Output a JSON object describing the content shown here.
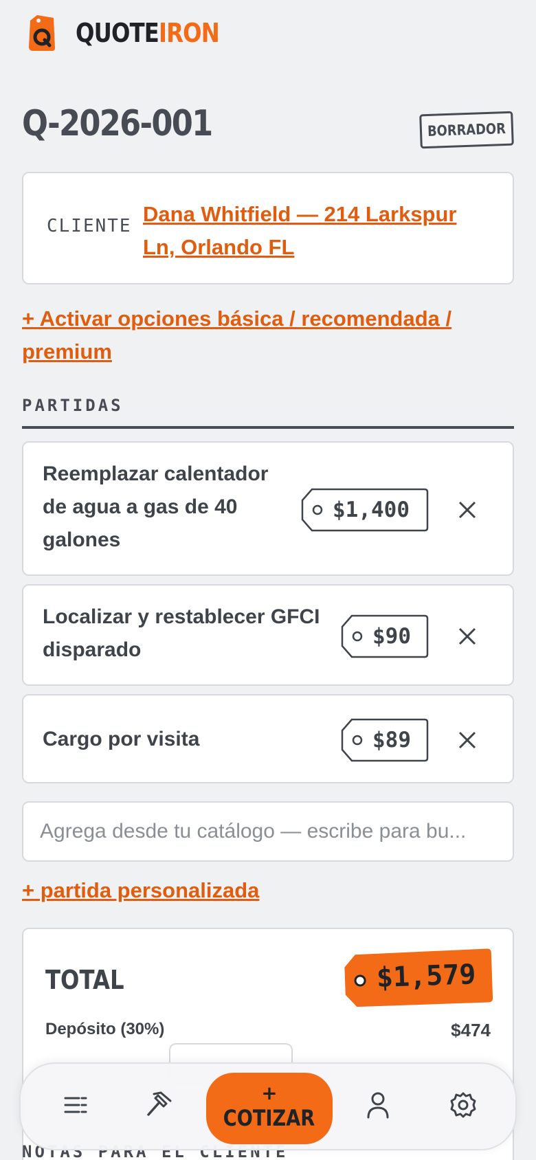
{
  "brand": {
    "part1": "QUOTE",
    "part2": "IRON"
  },
  "quote": {
    "id": "Q-2026-001",
    "status": "BORRADOR"
  },
  "client": {
    "label": "CLIENTE",
    "value": "Dana Whitfield — 214 Larkspur Ln, Orlando FL"
  },
  "options_link": "+ Activar opciones básica / recomendada / premium",
  "items_section": {
    "title": "PARTIDAS",
    "items": [
      {
        "description": "Reemplazar calentador de agua a gas de 40 galones",
        "price": "$1,400"
      },
      {
        "description": "Localizar y restablecer GFCI disparado",
        "price": "$90"
      },
      {
        "description": "Cargo por visita",
        "price": "$89"
      }
    ]
  },
  "catalog": {
    "placeholder": "Agrega desde tu catálogo — escribe para bu..."
  },
  "custom_item_link": "+ partida personalizada",
  "totals": {
    "label": "TOTAL",
    "total": "$1,579",
    "deposit_label": "Depósito (30%)",
    "deposit_value": "$474"
  },
  "notes": {
    "title": "NOTAS PARA EL CLIENTE"
  },
  "nav": {
    "items": [
      "list-icon",
      "hammer-icon",
      "user-icon",
      "settings-icon"
    ],
    "cta_plus": "+",
    "cta_label": "COTIZAR"
  },
  "colors": {
    "accent": "#f36a17",
    "link": "#e05d10",
    "text": "#3f444b",
    "background": "#f0f1f3"
  }
}
